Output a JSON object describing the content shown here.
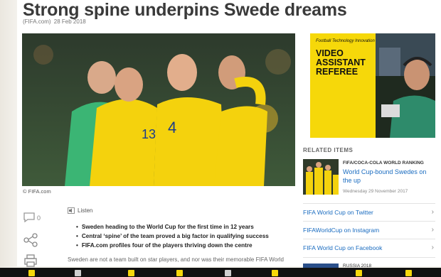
{
  "article": {
    "title": "Strong spine underpins Swede dreams",
    "source": "(FIFA.com)",
    "date": "28 Feb 2018",
    "image_credit": "© FIFA.com",
    "listen_label": "Listen",
    "comment_count": "0",
    "bullets": [
      "Sweden heading to the World Cup for the first time in 12 years",
      "Central ‘spine’ of the team proved a big factor in qualifying success",
      "FIFA.com profiles four of the players thriving down the centre"
    ],
    "body_start": "Sweden are not a team built on star players, and nor was their memorable FIFA World"
  },
  "ad": {
    "kicker": "Football Technology Innovation",
    "headline": "VIDEO ASSISTANT REFEREE"
  },
  "related": {
    "heading": "RELATED ITEMS",
    "item": {
      "kicker": "FIFA/COCA-COLA WORLD RANKING",
      "title": "World Cup-bound Swedes on the up",
      "date": "Wednesday 29 November 2017"
    },
    "links": [
      {
        "label": "FIFA World Cup on Twitter"
      },
      {
        "label": "FIFAWorldCup on Instagram"
      },
      {
        "label": "FIFA World Cup on Facebook"
      }
    ],
    "next_kicker": "RUSSIA 2018"
  },
  "hero": {
    "player_numbers": [
      "13",
      "4"
    ]
  },
  "colors": {
    "accent_yellow": "#f6d80a",
    "link_blue": "#1a6cc0"
  }
}
